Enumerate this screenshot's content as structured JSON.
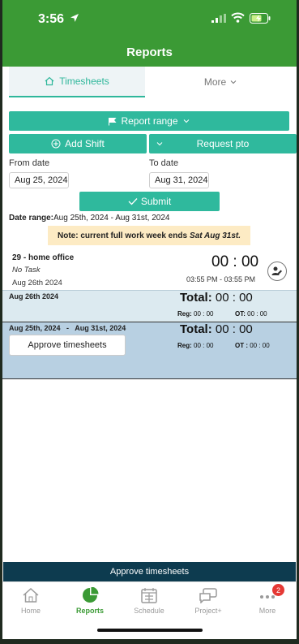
{
  "status": {
    "time": "3:56"
  },
  "header": {
    "title": "Reports"
  },
  "tabs": {
    "timesheets": "Timesheets",
    "more": "More"
  },
  "actions": {
    "report_range": "Report range",
    "add_shift": "Add Shift",
    "request_pto": "Request pto",
    "submit": "Submit"
  },
  "filters": {
    "from_label": "From date",
    "from_value": "Aug 25, 2024",
    "to_label": "To date",
    "to_value": "Aug 31, 2024"
  },
  "date_range": {
    "label": "Date range:",
    "value": "Aug 25th, 2024 - Aug 31st, 2024"
  },
  "note": {
    "text": "Note: current full work week ends",
    "date": "Sat Aug 31st."
  },
  "shift": {
    "title": "29 - home office",
    "task": "No Task",
    "date": "Aug 26th 2024",
    "duration": "00 : 00",
    "time_range": "03:55 PM - 03:55 PM"
  },
  "day_summary": {
    "date": "Aug 26th 2024",
    "total_label": "Total:",
    "total_value": "00 : 00",
    "reg_label": "Reg:",
    "reg_value": "00 : 00",
    "ot_label": "OT:",
    "ot_value": "00 : 00"
  },
  "week_summary": {
    "start": "Aug 25th, 2024",
    "sep": "-",
    "end": "Aug 31st, 2024",
    "total_label": "Total:",
    "total_value": "00 : 00",
    "reg_label": "Reg:",
    "reg_value": "00 : 00",
    "ot_label": "OT :",
    "ot_value": "00 : 00",
    "approve": "Approve timesheets"
  },
  "approve_bar": "Approve timesheets",
  "nav": {
    "home": "Home",
    "reports": "Reports",
    "schedule": "Schedule",
    "project": "Project+",
    "more": "More",
    "more_badge": "2"
  },
  "colors": {
    "brand_green": "#3b9a35",
    "teal": "#2fb99d",
    "navy": "#0d3b4f"
  }
}
